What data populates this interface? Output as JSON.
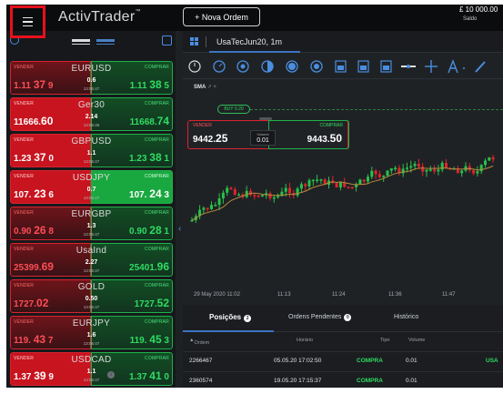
{
  "app": {
    "logo": "ActivTrader",
    "logo_tm": "™"
  },
  "topbar": {
    "new_order_label": "+  Nova Ordem",
    "balance": "£ 10 000.00",
    "balance_label": "Saldo"
  },
  "instruments": [
    {
      "symbol": "EURUSD",
      "sell_label": "VENDER",
      "buy_label": "COMPRAR",
      "sell_price_main": "1.11 ",
      "sell_price_big": "37",
      "sell_price_tail": " 9",
      "buy_price_main": "1.11 ",
      "buy_price_big": "38",
      "buy_price_tail": " 5",
      "volume": "0.6",
      "time": "13:06:47"
    },
    {
      "symbol": "Ger30",
      "sell_label": "VENDER",
      "buy_label": "COMPRAR",
      "sell_price_main": "11666.",
      "sell_price_big": "60",
      "sell_price_tail": "",
      "buy_price_main": "11668.",
      "buy_price_big": "74",
      "buy_price_tail": "",
      "volume": "2.14",
      "time": "13:06:46"
    },
    {
      "symbol": "GBPUSD",
      "sell_label": "VENDER",
      "buy_label": "COMPRAR",
      "sell_price_main": "1.23 ",
      "sell_price_big": "37",
      "sell_price_tail": " 0",
      "buy_price_main": "1.23 ",
      "buy_price_big": "38",
      "buy_price_tail": " 1",
      "volume": "1.1",
      "time": "13:06:47"
    },
    {
      "symbol": "USDJPY",
      "sell_label": "VENDER",
      "buy_label": "COMPRAR",
      "sell_price_main": "107. ",
      "sell_price_big": "23",
      "sell_price_tail": " 6",
      "buy_price_main": "107. ",
      "buy_price_big": "24",
      "buy_price_tail": " 3",
      "volume": "0.7",
      "time": "13:06:47"
    },
    {
      "symbol": "EURGBP",
      "sell_label": "VENDER",
      "buy_label": "COMPRAR",
      "sell_price_main": "0.90 ",
      "sell_price_big": "26",
      "sell_price_tail": " 8",
      "buy_price_main": "0.90 ",
      "buy_price_big": "28",
      "buy_price_tail": " 1",
      "volume": "1.3",
      "time": "13:06:47"
    },
    {
      "symbol": "UsaInd",
      "sell_label": "VENDER",
      "buy_label": "COMPRAR",
      "sell_price_main": "25399.",
      "sell_price_big": "69",
      "sell_price_tail": "",
      "buy_price_main": "25401.",
      "buy_price_big": "96",
      "buy_price_tail": "",
      "volume": "2.27",
      "time": "13:06:47"
    },
    {
      "symbol": "GOLD",
      "sell_label": "VENDER",
      "buy_label": "COMPRAR",
      "sell_price_main": "1727.",
      "sell_price_big": "02",
      "sell_price_tail": "",
      "buy_price_main": "1727.",
      "buy_price_big": "52",
      "buy_price_tail": "",
      "volume": "0.50",
      "time": "13:06:47"
    },
    {
      "symbol": "EURJPY",
      "sell_label": "VENDER",
      "buy_label": "COMPRAR",
      "sell_price_main": "119. ",
      "sell_price_big": "43",
      "sell_price_tail": " 7",
      "buy_price_main": "119. ",
      "buy_price_big": "45",
      "buy_price_tail": " 3",
      "volume": "1.6",
      "time": "13:06:47"
    },
    {
      "symbol": "USDCAD",
      "sell_label": "VENDER",
      "buy_label": "COMPRAR",
      "sell_price_main": "1.37 ",
      "sell_price_big": "39",
      "sell_price_tail": " 9",
      "buy_price_main": "1.37 ",
      "buy_price_big": "41",
      "buy_price_tail": " 0",
      "volume": "1.1",
      "time": "13:06:47"
    }
  ],
  "chart": {
    "tab_label": "UsaTecJun20, 1m",
    "indicator": "SMA",
    "indicator_icons": "↗ ×",
    "buy_pill": "BUY  0.20",
    "trade_widget": {
      "sell_label": "VENDER",
      "buy_label": "COMPRAR",
      "sell_main": "9442.",
      "sell_big": "25",
      "buy_main": "9443.",
      "buy_big": "50",
      "volume_label": "Volume",
      "volume": "0.01"
    },
    "x_labels": [
      "29 May 2020 11:02",
      "11:13",
      "11:24",
      "11:36",
      "11:47"
    ]
  },
  "bottom": {
    "tabs": [
      {
        "label": "Posições",
        "badge": "2"
      },
      {
        "label": "Ordens Pendentes",
        "badge": "0"
      },
      {
        "label": "Histórico"
      }
    ],
    "columns": [
      "Ordem",
      "Horário",
      "Tipo",
      "Volume"
    ],
    "rows": [
      {
        "order": "2266467",
        "time": "05.05.20 17:02:50",
        "type": "COMPRA",
        "volume": "0.01",
        "extra": "USA"
      },
      {
        "order": "2360574",
        "time": "19.05.20 17:15:37",
        "type": "COMPRA",
        "volume": "0.01",
        "extra": ""
      }
    ]
  },
  "colors": {
    "sell": "#d82330",
    "buy": "#1fb24a",
    "accent": "#4a8ee0",
    "highlight": "#e8101c"
  }
}
